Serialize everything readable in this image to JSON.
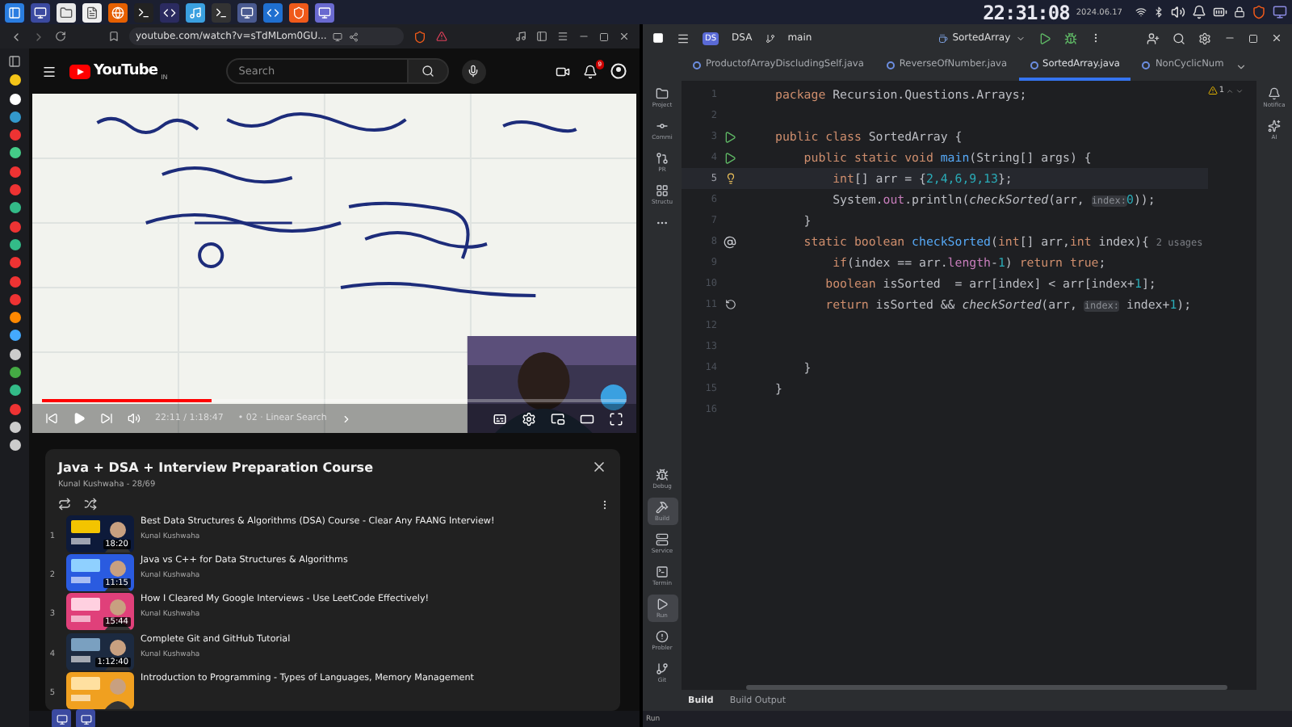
{
  "taskbar": {
    "clock": "22:31:08",
    "date": "2024.06.17"
  },
  "browser": {
    "url": "youtube.com/watch?v=sTdMLom0GU..."
  },
  "youtube": {
    "logo": "YouTube",
    "country": "IN",
    "search_placeholder": "Search",
    "notifications": "9",
    "video": {
      "level": 0.29,
      "time": "22:11 / 1:18:47",
      "chapter": "• 02 · Linear Search"
    },
    "playlist": {
      "title": "Java + DSA + Interview Preparation Course",
      "subtitle": "Kunal Kushwaha - 28/69",
      "items": [
        {
          "index": "1",
          "title": "Best Data Structures & Algorithms (DSA) Course - Clear Any FAANG Interview!",
          "channel": "Kunal Kushwaha",
          "duration": "18:20"
        },
        {
          "index": "2",
          "title": "Java vs C++ for Data Structures & Algorithms",
          "channel": "Kunal Kushwaha",
          "duration": "11:15"
        },
        {
          "index": "3",
          "title": "How I Cleared My Google Interviews - Use LeetCode Effectively!",
          "channel": "Kunal Kushwaha",
          "duration": "15:44"
        },
        {
          "index": "4",
          "title": "Complete Git and GitHub Tutorial",
          "channel": "Kunal Kushwaha",
          "duration": "1:12:40"
        },
        {
          "index": "5",
          "title": "Introduction to Programming - Types of Languages, Memory Management"
        }
      ]
    }
  },
  "ide": {
    "project_badge": "DS",
    "project": "DSA",
    "branch": "main",
    "run_config": "SortedArray",
    "warning_count": "1",
    "tabs": [
      {
        "label": "ProductofArrayDiscludingSelf.java",
        "selected": false
      },
      {
        "label": "ReverseOfNumber.java",
        "selected": false
      },
      {
        "label": "SortedArray.java",
        "selected": true
      },
      {
        "label": "NonCyclicNum",
        "selected": false
      }
    ],
    "left_tools_top": [
      {
        "kind": "folder",
        "label": "Project",
        "selected": false
      },
      {
        "kind": "commit",
        "label": "Commi",
        "selected": false
      },
      {
        "kind": "pr",
        "label": "PR",
        "selected": false
      },
      {
        "kind": "structure",
        "label": "Structu",
        "selected": false
      },
      {
        "kind": "more",
        "selected": false
      }
    ],
    "left_tools_bottom": [
      {
        "kind": "debug",
        "label": "Debug",
        "selected": false
      },
      {
        "kind": "build",
        "label": "Build",
        "selected": true
      },
      {
        "kind": "services",
        "label": "Service",
        "selected": false
      },
      {
        "kind": "terminal",
        "label": "Termin",
        "selected": false
      },
      {
        "kind": "run",
        "label": "Run",
        "selected": true
      },
      {
        "kind": "problems",
        "label": "Probler",
        "selected": false
      },
      {
        "kind": "git",
        "label": "Git",
        "selected": false
      }
    ],
    "right_tools": [
      {
        "kind": "notifications",
        "label": "Notifica"
      },
      {
        "kind": "ai",
        "label": "AI"
      }
    ],
    "code": [
      {
        "number": "1",
        "current": false,
        "tokens": [
          {
            "kind": "keyword",
            "text": "package "
          },
          {
            "kind": "plain",
            "text": "Recursion.Questions.Arrays;"
          }
        ]
      },
      {
        "number": "2",
        "current": false
      },
      {
        "number": "3",
        "current": false,
        "gutter": {
          "kind": "run"
        },
        "tokens": [
          {
            "kind": "keyword",
            "text": "public class "
          },
          {
            "kind": "plain",
            "text": "SortedArray {"
          }
        ]
      },
      {
        "number": "4",
        "current": false,
        "gutter": {
          "kind": "run"
        },
        "tokens": [
          {
            "kind": "keyword",
            "text": "    public static void "
          },
          {
            "kind": "method",
            "text": "main"
          },
          {
            "kind": "plain",
            "text": "(String[] args) {"
          }
        ]
      },
      {
        "number": "5",
        "current": true,
        "gutter": {
          "kind": "bulb"
        },
        "tokens": [
          {
            "kind": "keyword",
            "text": "        int"
          },
          {
            "kind": "plain",
            "text": "[] arr = {"
          },
          {
            "kind": "number",
            "text": "2,4,6,9,13"
          },
          {
            "kind": "plain",
            "text": "};"
          }
        ]
      },
      {
        "number": "6",
        "current": false,
        "tokens": [
          {
            "kind": "plain",
            "text": "        System."
          },
          {
            "kind": "field",
            "text": "out"
          },
          {
            "kind": "plain",
            "text": ".println("
          },
          {
            "kind": "call",
            "text": "checkSorted"
          },
          {
            "kind": "plain",
            "text": "(arr, "
          },
          {
            "kind": "hint",
            "text": "index:"
          },
          {
            "kind": "number",
            "text": "0"
          },
          {
            "kind": "plain",
            "text": "));"
          }
        ]
      },
      {
        "number": "7",
        "current": false,
        "tokens": [
          {
            "kind": "plain",
            "text": "    }"
          }
        ]
      },
      {
        "number": "8",
        "current": false,
        "gutter": {
          "kind": "override"
        },
        "tokens": [
          {
            "kind": "keyword",
            "text": "    static boolean "
          },
          {
            "kind": "method",
            "text": "checkSorted"
          },
          {
            "kind": "plain",
            "text": "("
          },
          {
            "kind": "keyword",
            "text": "int"
          },
          {
            "kind": "plain",
            "text": "[] arr,"
          },
          {
            "kind": "keyword",
            "text": "int"
          },
          {
            "kind": "plain",
            "text": " index){ "
          },
          {
            "kind": "usage",
            "text": "2 usages"
          }
        ]
      },
      {
        "number": "9",
        "current": false,
        "tokens": [
          {
            "kind": "keyword",
            "text": "        if"
          },
          {
            "kind": "plain",
            "text": "(index == arr."
          },
          {
            "kind": "field",
            "text": "length"
          },
          {
            "kind": "plain",
            "text": "-"
          },
          {
            "kind": "number",
            "text": "1"
          },
          {
            "kind": "plain",
            "text": ") "
          },
          {
            "kind": "keyword",
            "text": "return true"
          },
          {
            "kind": "plain",
            "text": ";"
          }
        ]
      },
      {
        "number": "10",
        "current": false,
        "tokens": [
          {
            "kind": "keyword",
            "text": "       boolean "
          },
          {
            "kind": "plain",
            "text": "isSorted  = arr[index] < arr[index+"
          },
          {
            "kind": "number",
            "text": "1"
          },
          {
            "kind": "plain",
            "text": "];"
          }
        ]
      },
      {
        "number": "11",
        "current": false,
        "gutter": {
          "kind": "recursion"
        },
        "tokens": [
          {
            "kind": "keyword",
            "text": "       return "
          },
          {
            "kind": "plain",
            "text": "isSorted && "
          },
          {
            "kind": "call",
            "text": "checkSorted"
          },
          {
            "kind": "plain",
            "text": "(arr, "
          },
          {
            "kind": "hint",
            "text": "index:"
          },
          {
            "kind": "plain",
            "text": " index+"
          },
          {
            "kind": "number",
            "text": "1"
          },
          {
            "kind": "plain",
            "text": ");"
          }
        ]
      },
      {
        "number": "12",
        "current": false
      },
      {
        "number": "13",
        "current": false
      },
      {
        "number": "14",
        "current": false,
        "tokens": [
          {
            "kind": "plain",
            "text": "    }"
          }
        ]
      },
      {
        "number": "15",
        "current": false,
        "tokens": [
          {
            "kind": "plain",
            "text": "}"
          }
        ]
      },
      {
        "number": "16",
        "current": false
      }
    ],
    "bottom_tabs": [
      {
        "label": "Build",
        "selected": true
      },
      {
        "label": "Build Output",
        "selected": false
      }
    ],
    "status": "Run"
  }
}
